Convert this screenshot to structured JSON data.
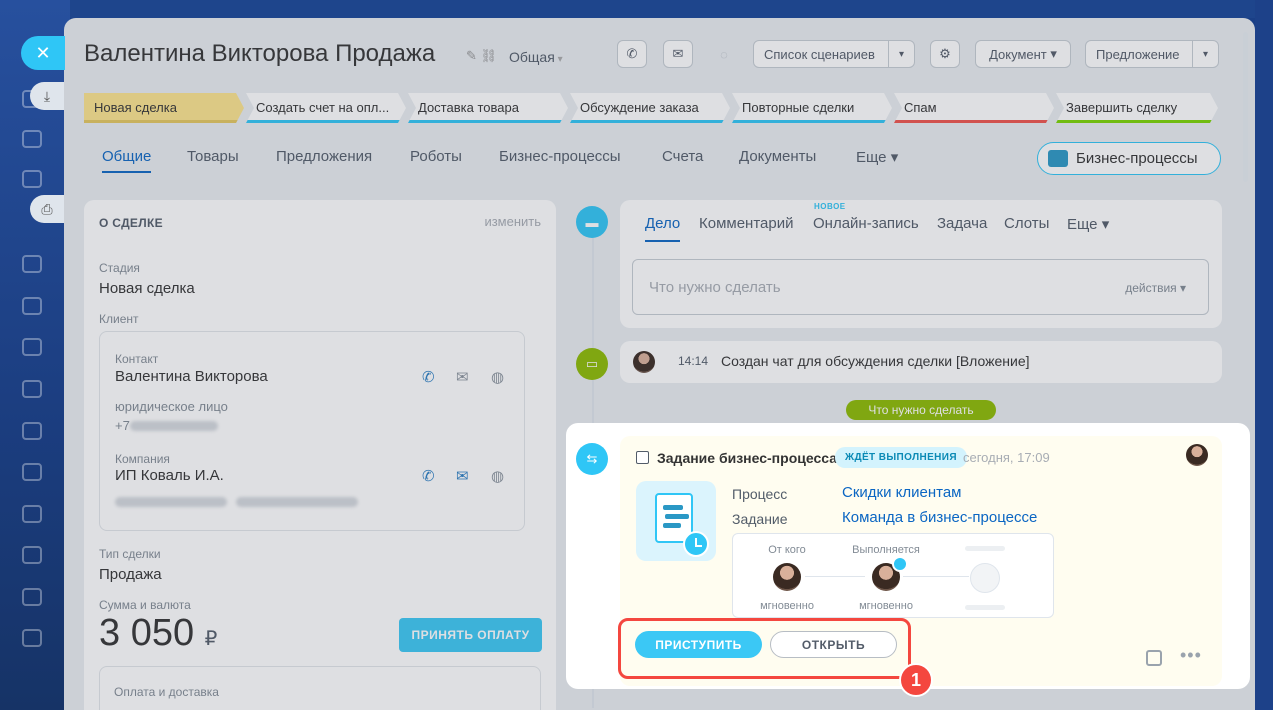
{
  "header": {
    "title": "Валентина Викторова Продажа",
    "category": "Общая",
    "scenarios_label": "Список сценариев",
    "document_label": "Документ",
    "offer_label": "Предложение"
  },
  "stages": [
    {
      "label": "Новая сделка",
      "state": "current"
    },
    {
      "label": "Создать счет на опл...",
      "state": "pending"
    },
    {
      "label": "Доставка товара",
      "state": "pending"
    },
    {
      "label": "Обсуждение заказа",
      "state": "pending"
    },
    {
      "label": "Повторные сделки",
      "state": "pending"
    },
    {
      "label": "Спам",
      "state": "fail"
    },
    {
      "label": "Завершить сделку",
      "state": "success"
    }
  ],
  "tabs": [
    {
      "label": "Общие",
      "active": true
    },
    {
      "label": "Товары"
    },
    {
      "label": "Предложения"
    },
    {
      "label": "Роботы"
    },
    {
      "label": "Бизнес-процессы"
    },
    {
      "label": "Счета"
    },
    {
      "label": "Документы"
    },
    {
      "label": "Еще"
    }
  ],
  "bp_button_label": "Бизнес-процессы",
  "about": {
    "heading": "О СДЕЛКЕ",
    "edit_label": "изменить",
    "stage_label": "Стадия",
    "stage_value": "Новая сделка",
    "client_label": "Клиент",
    "contact_label": "Контакт",
    "contact_name": "Валентина Викторова",
    "contact_type": "юридическое лицо",
    "contact_phone_prefix": "+7",
    "company_label": "Компания",
    "company_name": "ИП Коваль И.А.",
    "deal_type_label": "Тип сделки",
    "deal_type_value": "Продажа",
    "sum_label": "Сумма и валюта",
    "sum_value": "3 050",
    "currency": "₽",
    "pay_button": "ПРИНЯТЬ ОПЛАТУ",
    "payment_label": "Оплата и доставка"
  },
  "editor": {
    "tabs": [
      "Дело",
      "Комментарий",
      "Онлайн-запись",
      "Задача",
      "Слоты",
      "Еще"
    ],
    "new_badge": "НОВОЕ",
    "placeholder": "Что нужно сделать",
    "actions_label": "действия"
  },
  "timeline": {
    "chat_time": "14:14",
    "chat_text": "Создан чат для обсуждения сделки [Вложение]",
    "todo_pill": "Что нужно сделать"
  },
  "task": {
    "title": "Задание бизнес-процесса",
    "status_badge": "ЖДЁТ ВЫПОЛНЕНИЯ",
    "time": "сегодня, 17:09",
    "process_label": "Процесс",
    "process_value": "Скидки клиентам",
    "task_label": "Задание",
    "task_value": "Команда в бизнес-процессе",
    "from_label": "От кого",
    "exec_label": "Выполняется",
    "from_time": "мгновенно",
    "exec_time": "мгновенно",
    "start_button": "ПРИСТУПИТЬ",
    "open_button": "ОТКРЫТЬ",
    "marker": "1"
  },
  "colors": {
    "accent": "#2fc6f6",
    "link": "#0b66c3",
    "highlight": "#f4473f",
    "stage_current": "#fde58d",
    "todo_green": "#8dbb00"
  }
}
